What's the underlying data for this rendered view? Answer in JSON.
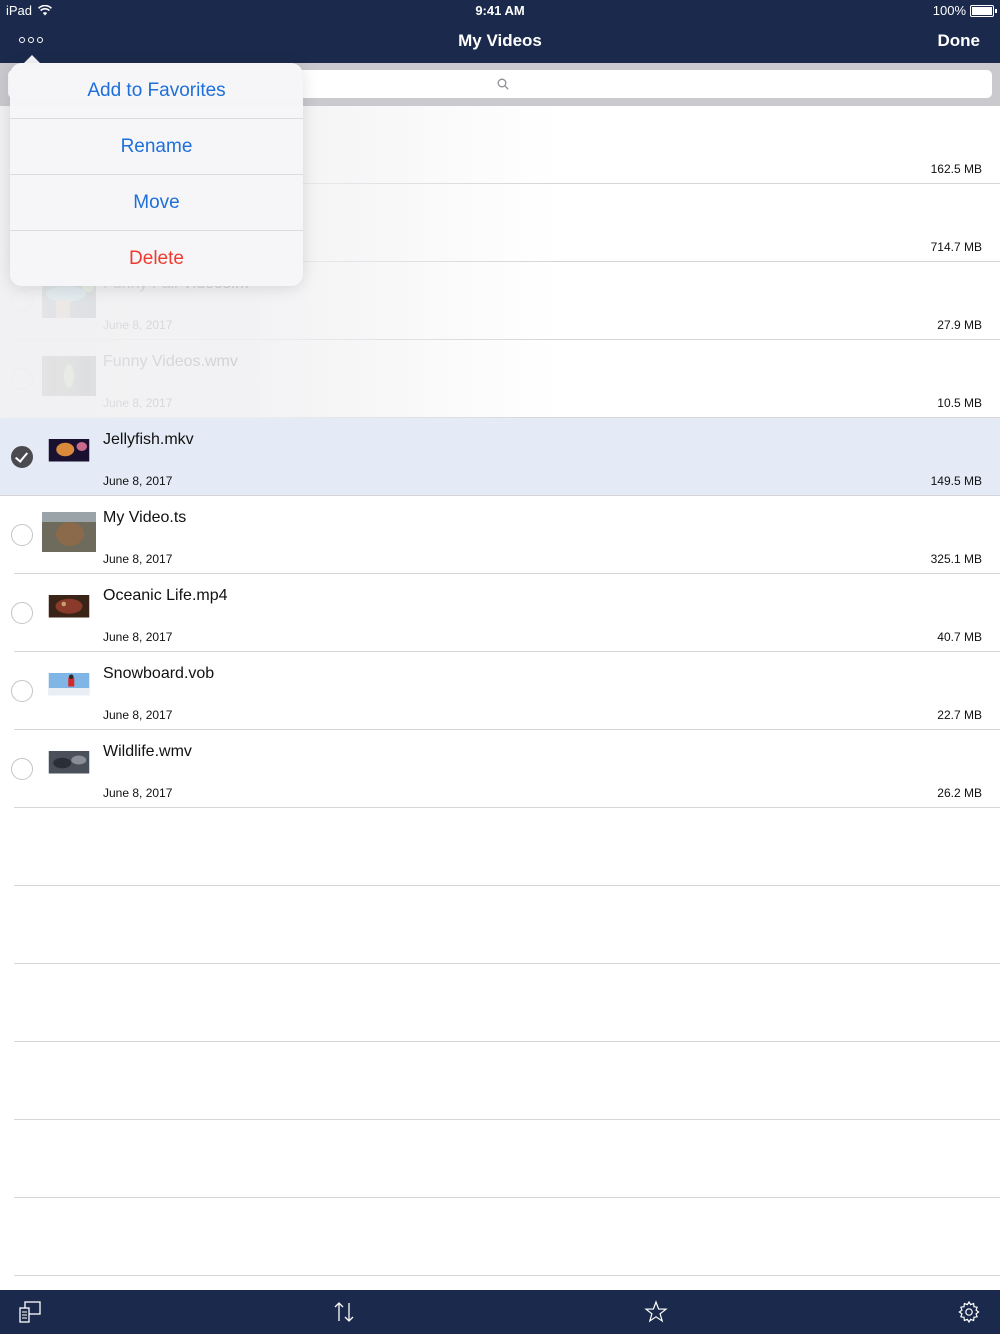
{
  "status": {
    "device": "iPad",
    "time": "9:41 AM",
    "battery": "100%"
  },
  "nav": {
    "title": "My Videos",
    "done_label": "Done",
    "more_icon": "more-icon"
  },
  "search": {
    "placeholder": ""
  },
  "menu": [
    {
      "label": "Add to Favorites",
      "style": "normal"
    },
    {
      "label": "Rename",
      "style": "normal"
    },
    {
      "label": "Move",
      "style": "normal"
    },
    {
      "label": "Delete",
      "style": "danger"
    }
  ],
  "files": [
    {
      "name": "",
      "date": "",
      "size": "162.5 MB",
      "selected": false,
      "hidden": true
    },
    {
      "name": "",
      "date": "",
      "size": "714.7 MB",
      "selected": false,
      "hidden": true
    },
    {
      "name": "Funny Fail Videos.m",
      "date": "June 8, 2017",
      "size": "27.9 MB",
      "selected": false
    },
    {
      "name": "Funny Videos.wmv",
      "date": "June 8, 2017",
      "size": "10.5 MB",
      "selected": false
    },
    {
      "name": "Jellyfish.mkv",
      "date": "June 8, 2017",
      "size": "149.5 MB",
      "selected": true
    },
    {
      "name": "My Video.ts",
      "date": "June 8, 2017",
      "size": "325.1 MB",
      "selected": false
    },
    {
      "name": "Oceanic Life.mp4",
      "date": "June 8, 2017",
      "size": "40.7 MB",
      "selected": false
    },
    {
      "name": "Snowboard.vob",
      "date": "June 8, 2017",
      "size": "22.7 MB",
      "selected": false
    },
    {
      "name": "Wildlife.wmv",
      "date": "June 8, 2017",
      "size": "26.2 MB",
      "selected": false
    }
  ],
  "toolbar": {
    "icons": [
      "devices-icon",
      "sort-icon",
      "star-icon",
      "gear-icon"
    ]
  },
  "colors": {
    "bar": "#1b2a4c",
    "link": "#1e6fd9",
    "danger": "#ee3b30",
    "selected_row": "#e4ebf6"
  }
}
